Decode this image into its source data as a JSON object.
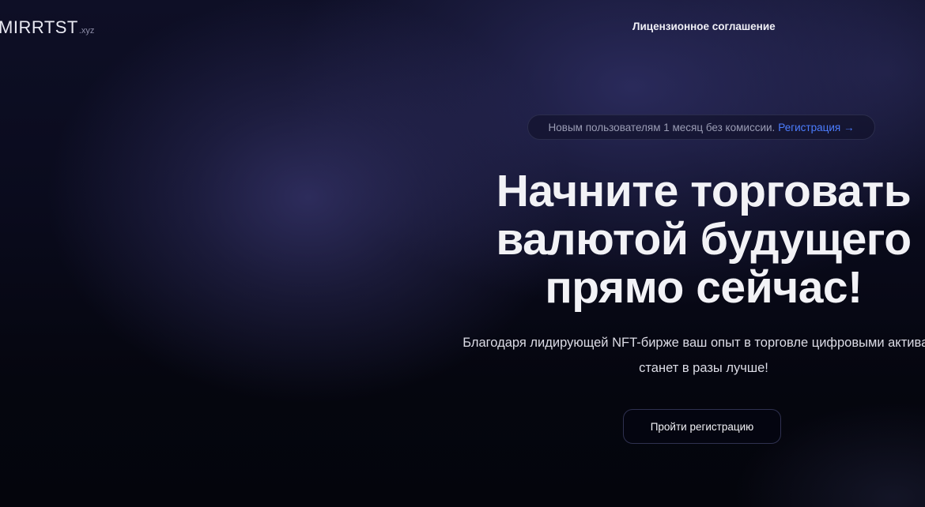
{
  "header": {
    "logo_main": "MIRRTST",
    "logo_sub": ".xyz",
    "nav_link": "Лицензионное соглашение"
  },
  "announcement": {
    "text": "Новым пользователям 1 месяц без комиссии.",
    "link": "Регистрация →"
  },
  "hero": {
    "headline_lines": [
      "Начните торговать",
      "валютой будущего",
      "прямо сейчас!"
    ],
    "subtext_lines": [
      "Благодаря лидирующей NFT-бирже ваш опыт в торговле цифровыми активами",
      "станет в разы лучше!"
    ],
    "cta_label": "Пройти регистрацию"
  },
  "colors": {
    "accent_link": "#4c7dff",
    "background": "#05060f"
  }
}
